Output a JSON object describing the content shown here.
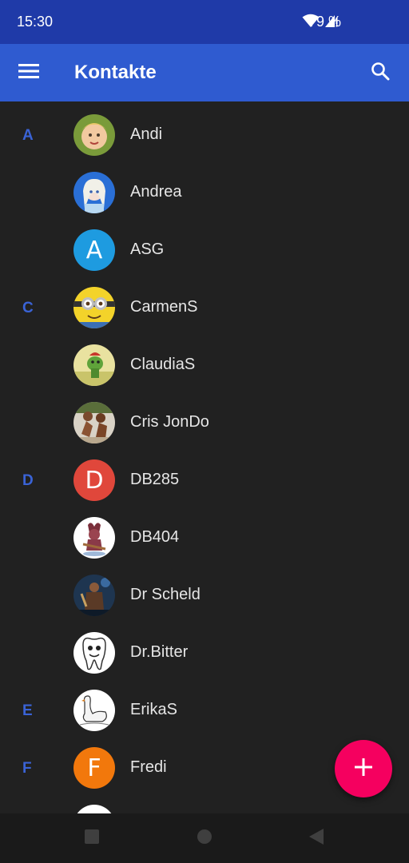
{
  "status_bar": {
    "time": "15:30",
    "battery": "79 %",
    "icons": [
      "wifi-icon",
      "cell-signal-icon"
    ]
  },
  "app_bar": {
    "title": "Kontakte",
    "menu_icon": "hamburger-menu-icon",
    "search_icon": "search-icon",
    "color": "#2f5bd0"
  },
  "contacts": [
    {
      "section": "A",
      "name": "Andi",
      "avatar": "photo-toddler"
    },
    {
      "section": "",
      "name": "Andrea",
      "avatar": "photo-princess"
    },
    {
      "section": "",
      "name": "ASG",
      "avatar": "letter",
      "avatar_letter": "A",
      "avatar_color": "#1e9be0"
    },
    {
      "section": "C",
      "name": "CarmenS",
      "avatar": "photo-minion"
    },
    {
      "section": "",
      "name": "ClaudiaS",
      "avatar": "photo-frog"
    },
    {
      "section": "",
      "name": "Cris JonDo",
      "avatar": "photo-figures"
    },
    {
      "section": "D",
      "name": "DB285",
      "avatar": "letter",
      "avatar_letter": "D",
      "avatar_color": "#e0473b"
    },
    {
      "section": "",
      "name": "DB404",
      "avatar": "photo-cartoon-guitar"
    },
    {
      "section": "",
      "name": "Dr Scheld",
      "avatar": "photo-warrior"
    },
    {
      "section": "",
      "name": "Dr.Bitter",
      "avatar": "photo-tooth"
    },
    {
      "section": "E",
      "name": "ErikaS",
      "avatar": "photo-swan"
    },
    {
      "section": "F",
      "name": "Fredi",
      "avatar": "letter",
      "avatar_letter": "F",
      "avatar_color": "#f2780c"
    }
  ],
  "fab": {
    "icon": "plus-icon",
    "color": "#f5005f"
  },
  "nav_bar": {
    "icons": [
      "recents-square-icon",
      "home-circle-icon",
      "back-triangle-icon"
    ]
  },
  "colors": {
    "accent": "#3a63d6",
    "background": "#212121",
    "status_bar": "#1f3aa8"
  }
}
